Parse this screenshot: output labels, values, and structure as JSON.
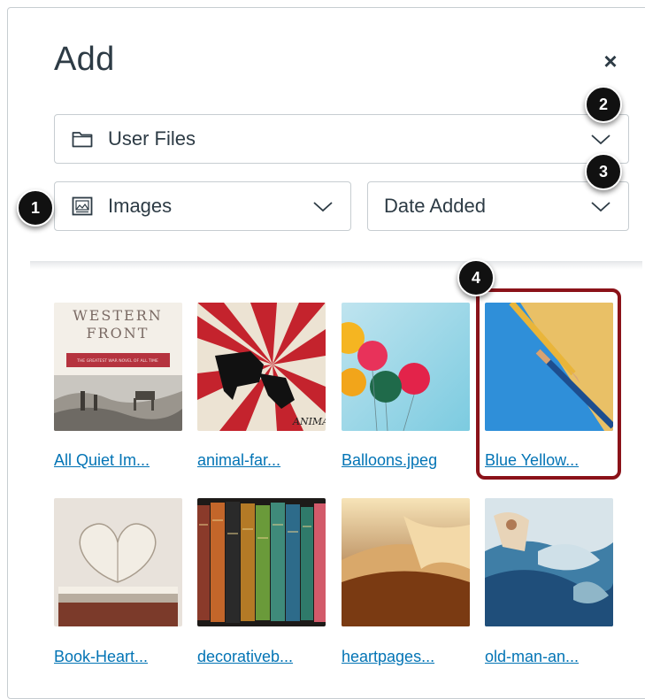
{
  "dialog": {
    "title": "Add",
    "close_glyph": "×"
  },
  "filters": {
    "source": {
      "label": "User Files",
      "icon": "folder-icon"
    },
    "content_type": {
      "label": "Images",
      "icon": "image-icon"
    },
    "sort": {
      "label": "Date Added"
    }
  },
  "callouts": [
    "1",
    "2",
    "3",
    "4"
  ],
  "images": [
    {
      "label": "All Quiet Im...",
      "cover_line1": "WESTERN",
      "cover_line2": "FRONT",
      "cover_tag": "THE GREATEST WAR NOVEL OF ALL TIME"
    },
    {
      "label": "animal-far...",
      "cover_text": "ANIMAL FA"
    },
    {
      "label": "Balloons.jpeg"
    },
    {
      "label": "Blue Yellow..."
    },
    {
      "label": "Book-Heart..."
    },
    {
      "label": "decorativeb..."
    },
    {
      "label": "heartpages..."
    },
    {
      "label": "old-man-an..."
    }
  ],
  "colors": {
    "link": "#0374b5",
    "highlight": "#8b1219",
    "border": "#c7cdd1",
    "text": "#2d3b45"
  }
}
